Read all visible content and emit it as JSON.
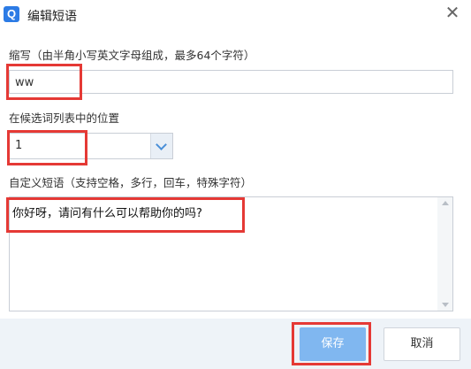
{
  "dialog": {
    "icon_letter": "Q",
    "title": "编辑短语",
    "close_glyph": "✕"
  },
  "abbreviation": {
    "label": "缩写（由半角小写英文字母组成，最多64个字符）",
    "value": "ww"
  },
  "position": {
    "label": "在候选词列表中的位置",
    "value": "1"
  },
  "custom_phrase": {
    "label": "自定义短语（支持空格，多行，回车，特殊字符）",
    "value": "你好呀，请问有什么可以帮助你的吗?"
  },
  "buttons": {
    "save_label": "保存",
    "cancel_label": "取消"
  },
  "colors": {
    "accent": "#2c7be5",
    "save_button": "#80b7f0",
    "highlight_box": "#e53935",
    "footer_bg": "#eef3f8"
  }
}
